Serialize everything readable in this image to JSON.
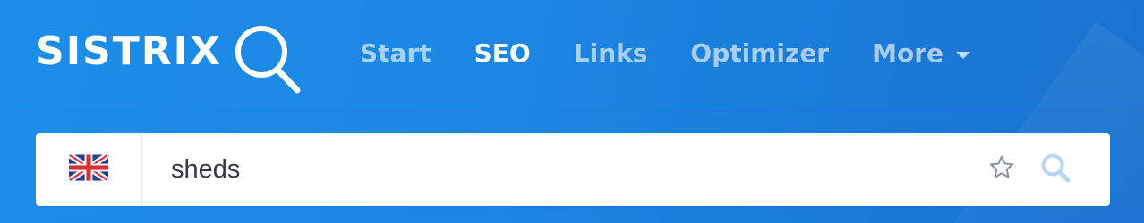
{
  "header": {
    "logo_text": "SISTRIX",
    "nav": [
      {
        "label": "Start",
        "active": false
      },
      {
        "label": "SEO",
        "active": true
      },
      {
        "label": "Links",
        "active": false
      },
      {
        "label": "Optimizer",
        "active": false
      },
      {
        "label": "More",
        "active": false,
        "has_dropdown": true
      }
    ]
  },
  "search": {
    "country_flag": "uk-flag-icon",
    "query_value": "sheds",
    "favorite_icon": "star-outline-icon",
    "search_icon": "search-icon"
  },
  "colors": {
    "background": "#1c86e2",
    "nav_active": "#ffffff",
    "search_icon": "#b9d4ee",
    "star_icon": "#8a939b"
  }
}
